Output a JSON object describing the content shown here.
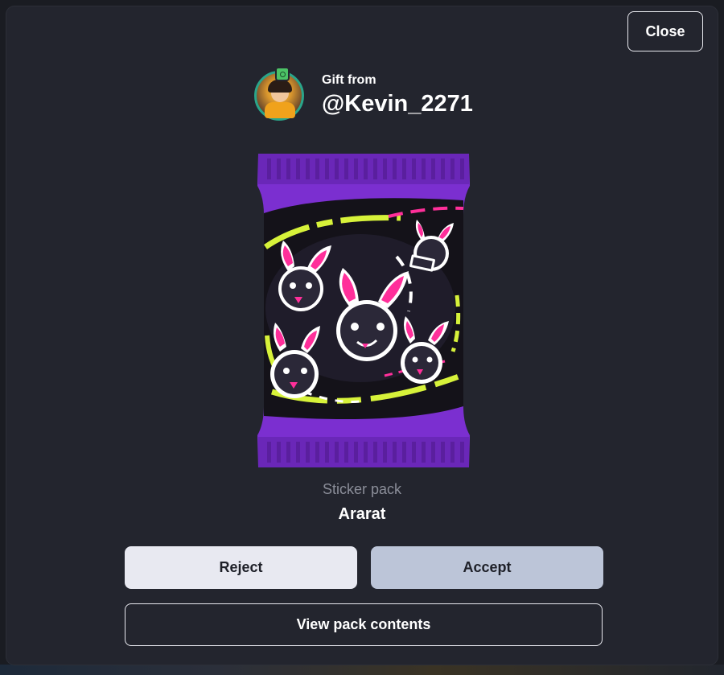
{
  "dialog": {
    "close_label": "Close"
  },
  "sender": {
    "gift_from_label": "Gift from",
    "username": "@Kevin_2271",
    "avatar_icon": "user-avatar"
  },
  "pack": {
    "type_label": "Sticker pack",
    "name": "Ararat",
    "art_icon": "sticker-pack-art",
    "colors": {
      "wrapper": "#7b2fd0",
      "accent_lime": "#d7f23a",
      "accent_pink": "#ff2f9a",
      "creature": "#2b2838"
    }
  },
  "actions": {
    "reject_label": "Reject",
    "accept_label": "Accept",
    "view_contents_label": "View pack contents"
  },
  "theme": {
    "modal_bg": "#23252e",
    "reject_bg": "#e8e9f1",
    "accept_bg": "#bcc5d8"
  }
}
